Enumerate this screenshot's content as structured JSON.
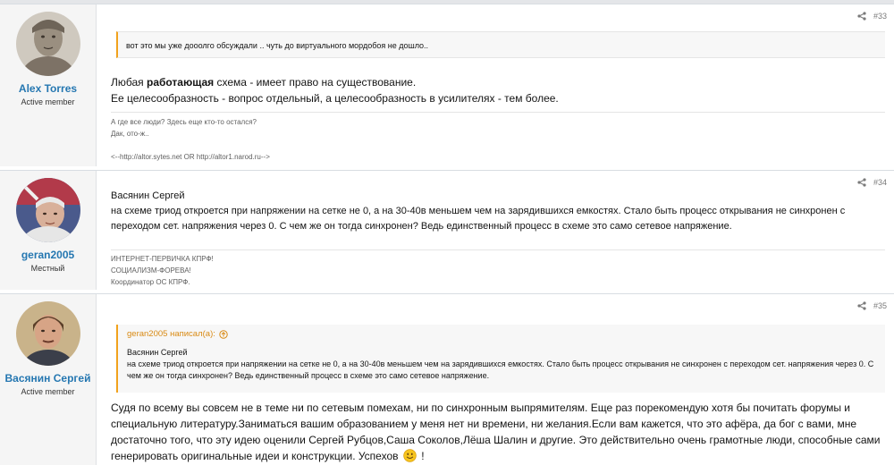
{
  "posts": [
    {
      "number": "#33",
      "user": {
        "name": "Alex Torres",
        "title": "Active member"
      },
      "quote": {
        "text": "вот это мы уже дооолго обсуждали .. чуть до виртуального мордобоя не дошло.."
      },
      "body": {
        "line1_a": "Любая ",
        "line1_bold": "работающая",
        "line1_b": " схема - имеет право на существование.",
        "line2": "Ее целесообразность - вопрос отдельный, а целесообразность в усилителях - тем более."
      },
      "signature": {
        "line1": "А где все люди? Здесь еще кто-то остался?",
        "line2": "Дак, ото-ж..",
        "line3": "<--http://altor.sytes.net OR http://altor1.narod.ru-->"
      }
    },
    {
      "number": "#34",
      "user": {
        "name": "geran2005",
        "title": "Местный"
      },
      "body": {
        "line1": "Васянин Сергей",
        "line2": "на схеме триод откроется при напряжении на сетке не 0, а на 30-40в меньшем чем на зарядившихся емкостях. Стало быть процесс открывания не синхронен с переходом сет. напряжения через 0. С чем же он тогда синхронен? Ведь единственный процесс в схеме это само сетевое напряжение."
      },
      "signature": {
        "line1": "ИНТЕРНЕТ-ПЕРВИЧКА КПРФ!",
        "line2": "СОЦИАЛИЗМ-ФОРЕВА!",
        "line3": "Координатор ОС КПРФ."
      }
    },
    {
      "number": "#35",
      "user": {
        "name": "Васянин Сергей",
        "title": "Active member"
      },
      "quote": {
        "author": "geran2005 написал(а):",
        "line1": "Васянин Сергей",
        "line2": "на схеме триод откроется при напряжении на сетке не 0, а на 30-40в меньшем чем на зарядившихся емкостях. Стало быть процесс открывания не синхронен с переходом сет. напряжения через 0. С чем же он тогда синхронен? Ведь единственный процесс в схеме это само сетевое напряжение."
      },
      "body": {
        "text": "Судя по всему вы совсем не в теме ни по сетевым помехам, ни по синхронным выпрямителям. Еще раз порекомендую хотя бы почитать форумы и специальную литературу.Заниматься вашим образованием у меня нет ни времени, ни желания.Если вам кажется, что это афёра, да бог с вами, мне достаточно того, что эту идею оценили Сергей Рубцов,Саша Соколов,Лёша Шалин и другие. Это действительно очень грамотные люди, способные сами генерировать оригинальные идеи и конструкции. Успехов",
        "tail": " !"
      }
    }
  ],
  "icons": {
    "share": "share-icon",
    "quote_arrow": "arrow-up-circle-icon",
    "smile": "smile-emoji-icon"
  },
  "colors": {
    "username": "#2577b1",
    "quote_accent": "#f1a21c",
    "quote_author": "#d98a14"
  }
}
